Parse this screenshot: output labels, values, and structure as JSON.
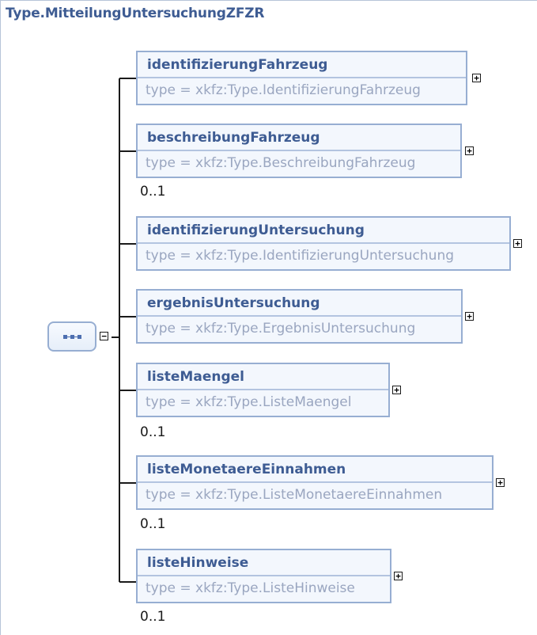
{
  "diagram": {
    "title": "Type.MitteilungUntersuchungZFZR",
    "sequence_icon": "sequence-icon",
    "collapse_symbol": "−",
    "expand_symbol": "+",
    "elements": [
      {
        "name": "identifizierungFahrzeug",
        "type": "type = xkfz:Type.IdentifizierungFahrzeug",
        "occurrence": ""
      },
      {
        "name": "beschreibungFahrzeug",
        "type": "type = xkfz:Type.BeschreibungFahrzeug",
        "occurrence": "0..1"
      },
      {
        "name": "identifizierungUntersuchung",
        "type": "type = xkfz:Type.IdentifizierungUntersuchung",
        "occurrence": ""
      },
      {
        "name": "ergebnisUntersuchung",
        "type": "type = xkfz:Type.ErgebnisUntersuchung",
        "occurrence": ""
      },
      {
        "name": "listeMaengel",
        "type": "type = xkfz:Type.ListeMaengel",
        "occurrence": "0..1"
      },
      {
        "name": "listeMonetaereEinnahmen",
        "type": "type = xkfz:Type.ListeMonetaereEinnahmen",
        "occurrence": "0..1"
      },
      {
        "name": "listeHinweise",
        "type": "type = xkfz:Type.ListeHinweise",
        "occurrence": "0..1"
      }
    ]
  },
  "colors": {
    "title": "#3e5c93",
    "box_border": "#97aed2",
    "box_fill": "#f3f7fd",
    "type_text": "#9aa6c0",
    "connector": "#1a1a1a"
  }
}
